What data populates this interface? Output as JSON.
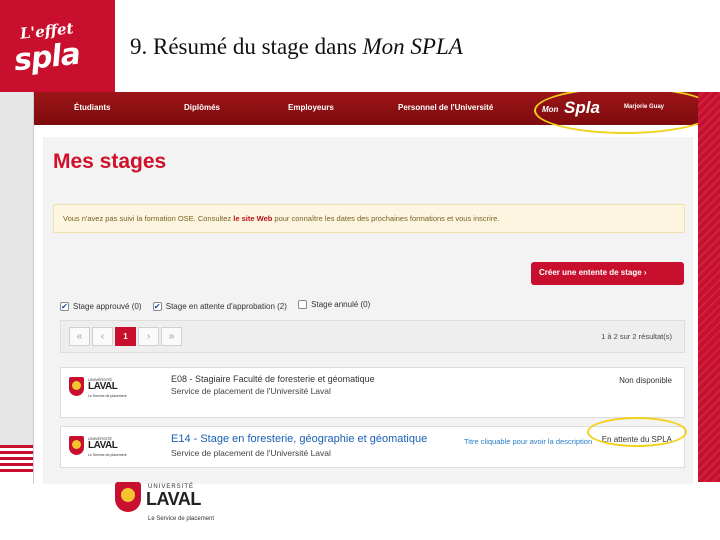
{
  "slide": {
    "logo_effet": "L'effet",
    "logo_spla": "spla",
    "title_main": "9. Résumé du stage dans ",
    "title_italic": "Mon SPLA"
  },
  "nav": {
    "items": [
      "Étudiants",
      "Diplômés",
      "Employeurs",
      "Personnel de l'Université"
    ],
    "mon": "Mon",
    "spla": "Spla",
    "user": "Marjorie Guay"
  },
  "page": {
    "title": "Mes stages",
    "alert_before": "Vous n'avez pas suivi la formation OSE. Consultez ",
    "alert_link": "le site Web",
    "alert_after": " pour connaître les dates des prochaines formations et vous inscrire.",
    "create_button": "Créer une entente de stage ›"
  },
  "filters": [
    {
      "label": "Stage approuvé (0)",
      "checked": true
    },
    {
      "label": "Stage en attente d'approbation (2)",
      "checked": true
    },
    {
      "label": "Stage annulé (0)",
      "checked": false
    }
  ],
  "pager": {
    "first": "«",
    "prev": "‹",
    "current": "1",
    "next": "›",
    "last": "»",
    "results": "1 à 2 sur 2 résultat(s)"
  },
  "stages": [
    {
      "univ_small": "UNIVERSITÉ",
      "univ_big": "LAVAL",
      "univ_serv": "Le Service de placement",
      "title": "E08 - Stagiaire Faculté de foresterie et géomatique",
      "sub": "Service de placement de l'Université Laval",
      "status": "Non disponible"
    },
    {
      "univ_small": "UNIVERSITÉ",
      "univ_big": "LAVAL",
      "univ_serv": "Le Service de placement",
      "title": "E14 - Stage en foresterie, géographie et géomatique",
      "sub": "Service de placement de l'Université Laval",
      "tip": "Titre cliquable pour avoir la description",
      "status": "En attente du SPLA"
    }
  ],
  "bottom_logo": {
    "small": "UNIVERSITÉ",
    "big": "LAVAL",
    "service": "Le Service de placement"
  },
  "colors": {
    "brand_red": "#c8102e",
    "nav_dark_red": "#8b0f12",
    "highlight_yellow": "#f1d21c",
    "link_blue": "#1a5fb4"
  }
}
